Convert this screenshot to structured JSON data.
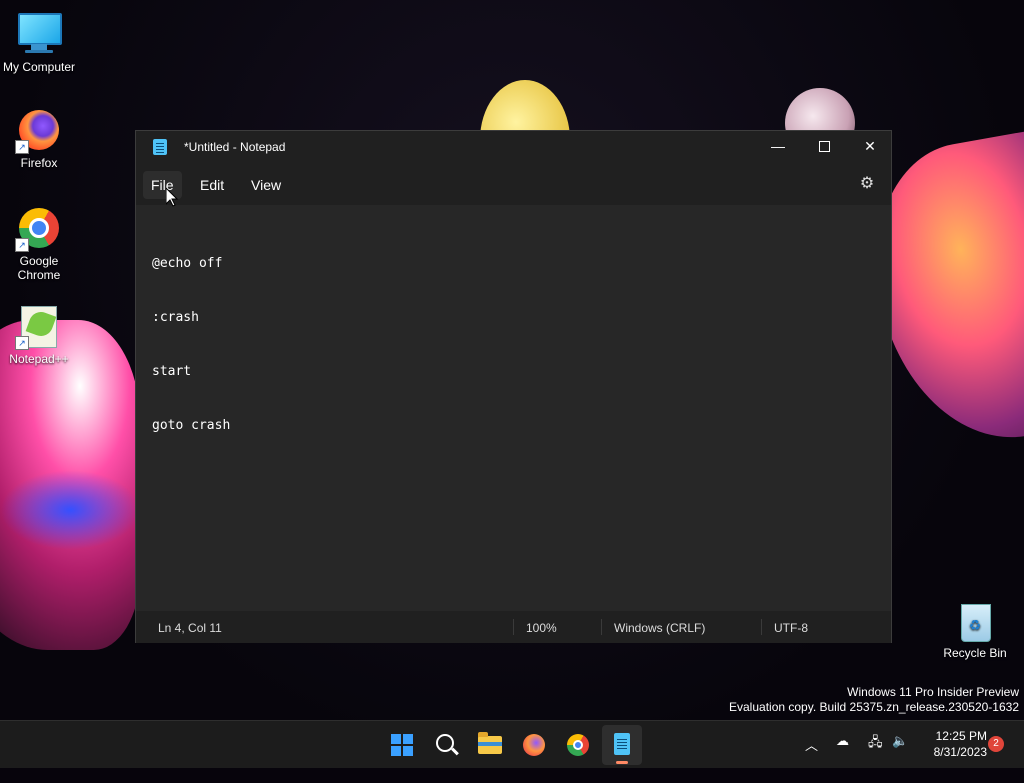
{
  "desktop": {
    "icons": [
      {
        "label": "My Computer"
      },
      {
        "label": "Firefox"
      },
      {
        "label": "Google Chrome"
      },
      {
        "label": "Notepad++"
      },
      {
        "label": "Recycle Bin"
      }
    ]
  },
  "window": {
    "title": "*Untitled - Notepad",
    "controls": {
      "minimize": "—",
      "maximize": "□",
      "close": "✕"
    }
  },
  "menu": {
    "file": "File",
    "edit": "Edit",
    "view": "View"
  },
  "editor": {
    "lines": [
      "@echo off",
      ":crash",
      "start",
      "goto crash"
    ]
  },
  "status": {
    "position": "Ln 4, Col 11",
    "zoom": "100%",
    "line_ending": "Windows (CRLF)",
    "encoding": "UTF-8"
  },
  "watermark": {
    "line1": "Windows 11 Pro Insider Preview",
    "line2": "Evaluation copy. Build 25375.zn_release.230520-1632"
  },
  "taskbar": {
    "apps": [
      "start-icon",
      "search-icon",
      "file-explorer-icon",
      "firefox-icon",
      "chrome-icon",
      "notepad-icon"
    ],
    "time": "12:25 PM",
    "date": "8/31/2023",
    "notification_count": "2"
  },
  "colors": {
    "accent": "#ff8a65",
    "notepad_icon": "#4fc3f7",
    "notification": "#e0453a"
  }
}
